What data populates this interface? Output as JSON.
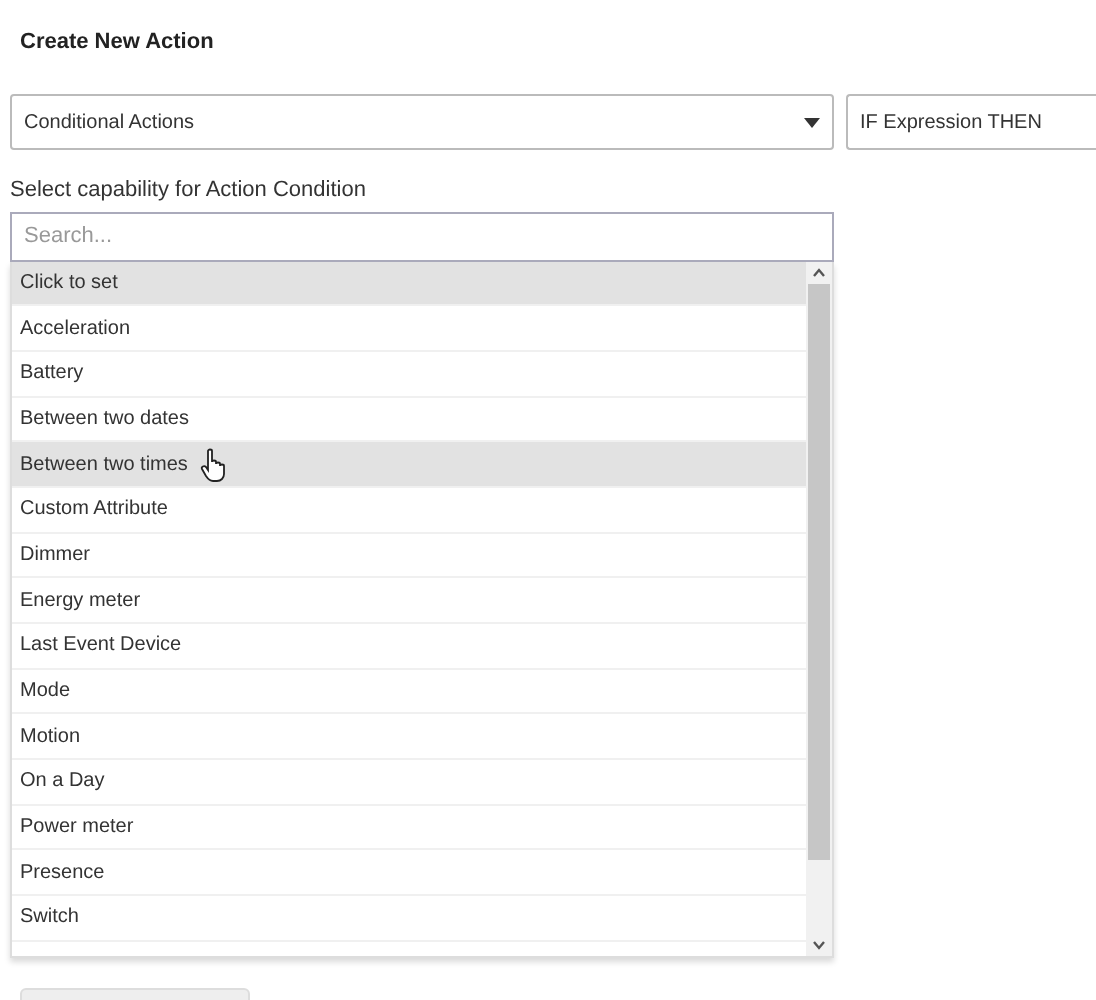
{
  "title": "Create New Action",
  "action_type": {
    "value": "Conditional Actions"
  },
  "action_subtype": {
    "value": "IF Expression THEN"
  },
  "capability_label": "Select capability for Action Condition",
  "search": {
    "placeholder": "Search..."
  },
  "options": [
    {
      "label": "Click to set",
      "highlighted": true
    },
    {
      "label": "Acceleration",
      "highlighted": false
    },
    {
      "label": "Battery",
      "highlighted": false
    },
    {
      "label": "Between two dates",
      "highlighted": false
    },
    {
      "label": "Between two times",
      "highlighted": true
    },
    {
      "label": "Custom Attribute",
      "highlighted": false
    },
    {
      "label": "Dimmer",
      "highlighted": false
    },
    {
      "label": "Energy meter",
      "highlighted": false
    },
    {
      "label": "Last Event Device",
      "highlighted": false
    },
    {
      "label": "Mode",
      "highlighted": false
    },
    {
      "label": "Motion",
      "highlighted": false
    },
    {
      "label": "On a Day",
      "highlighted": false
    },
    {
      "label": "Power meter",
      "highlighted": false
    },
    {
      "label": "Presence",
      "highlighted": false
    },
    {
      "label": "Switch",
      "highlighted": false
    }
  ]
}
